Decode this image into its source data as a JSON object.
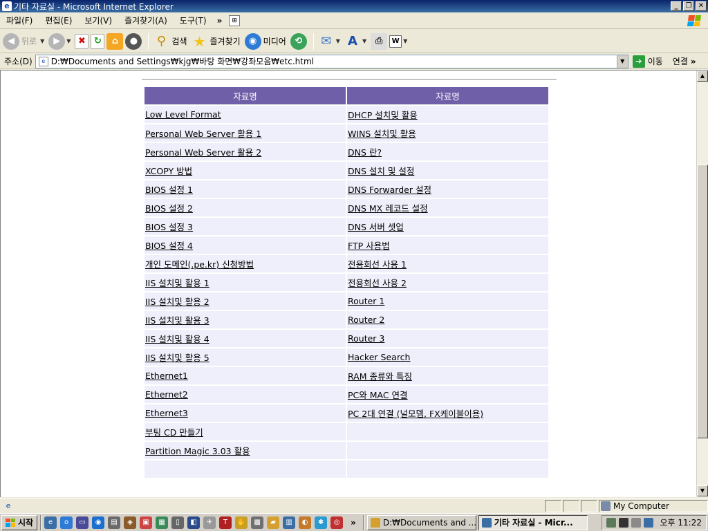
{
  "window": {
    "title": "기타 자료실 - Microsoft Internet Explorer"
  },
  "menu": [
    "파일(F)",
    "편집(E)",
    "보기(V)",
    "즐겨찾기(A)",
    "도구(T)"
  ],
  "menu_more": "»",
  "toolbar": {
    "back_label": "뒤로",
    "search_label": "검색",
    "favorites_label": "즐겨찾기",
    "media_label": "미디어"
  },
  "address": {
    "label": "주소(D)",
    "url": "D:₩Documents and Settings₩kjg₩바탕 화면₩강좌모음₩etc.html",
    "go_label": "이동",
    "links_label": "연결",
    "links_more": "»"
  },
  "table": {
    "headers": [
      "자료명",
      "자료명"
    ],
    "rows": [
      [
        "Low Level Format",
        "DHCP 설치및 활용"
      ],
      [
        "Personal Web Server 활용 1",
        "WINS 설치및 활용"
      ],
      [
        "Personal Web Server 활용 2",
        "DNS 란?"
      ],
      [
        "XCOPY 방법",
        "DNS 설치 및 설정"
      ],
      [
        "BIOS 설정 1",
        "DNS Forwarder 설정"
      ],
      [
        "BIOS 설정 2",
        "DNS MX 레코드 설정"
      ],
      [
        "BIOS 설정 3",
        "DNS 서버 셋업"
      ],
      [
        "BIOS 설정 4",
        "FTP 사용법"
      ],
      [
        "개인 도메인(.pe.kr) 신청방법",
        "전용회선 사용 1"
      ],
      [
        "IIS 설치및 활용 1",
        "전용회선 사용 2"
      ],
      [
        "IIS 설치및 활용 2",
        "Router 1"
      ],
      [
        "IIS 설치및 활용 3",
        "Router 2"
      ],
      [
        "IIS 설치및 활용 4",
        "Router 3"
      ],
      [
        "IIS 설치및 활용 5",
        "Hacker Search"
      ],
      [
        "Ethernet1",
        "RAM 종류와 특징"
      ],
      [
        "Ethernet2",
        "PC와 MAC 연결"
      ],
      [
        "Ethernet3",
        "PC 2대 연결 (널모뎀, FX케이블이용)"
      ],
      [
        "부팅  CD 만들기",
        ""
      ],
      [
        "Partition  Magic  3.03  활용",
        ""
      ],
      [
        "",
        ""
      ]
    ]
  },
  "status": {
    "zone": "My Computer"
  },
  "taskbar": {
    "start_label": "시작",
    "ql_more": "»",
    "tasks": [
      "D:₩Documents and ...",
      "기타 자료실 - Micr..."
    ],
    "clock": "오후 11:22"
  },
  "colors": {
    "header_bg": "#6f5fa8",
    "cell_bg": "#efeffb",
    "titlebar": "#0a246a"
  }
}
